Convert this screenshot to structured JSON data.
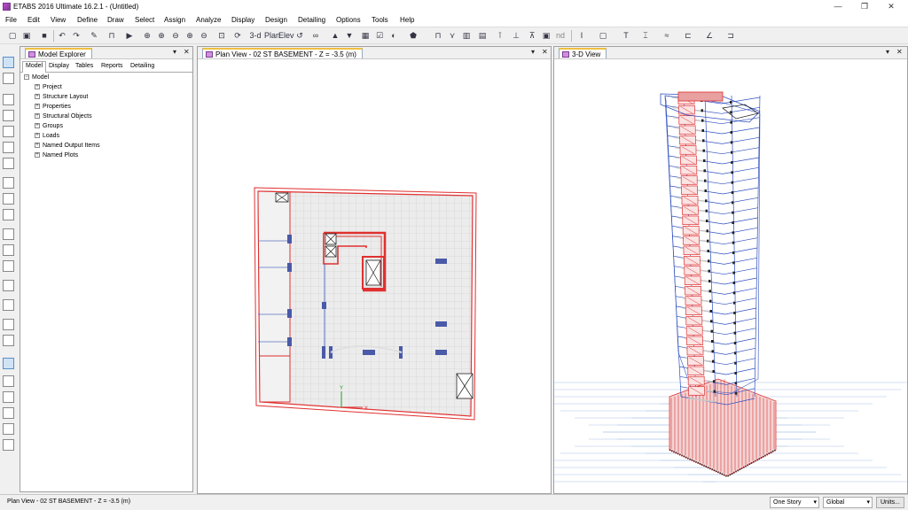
{
  "window": {
    "title": "ETABS 2016 Ultimate 16.2.1 - (Untitled)",
    "controls": [
      "—",
      "❐",
      "✕"
    ]
  },
  "menu": [
    "File",
    "Edit",
    "View",
    "Define",
    "Draw",
    "Select",
    "Assign",
    "Analyze",
    "Display",
    "Design",
    "Detailing",
    "Options",
    "Tools",
    "Help"
  ],
  "toolbar": {
    "view_3d_label": "3-d",
    "plan_label": "Plan",
    "elev_label": "Elev",
    "nd_label": "nd"
  },
  "model_explorer": {
    "title": "Model Explorer",
    "tabs": [
      "Model",
      "Display",
      "Tables",
      "Reports",
      "Detailing"
    ],
    "active_tab": "Model",
    "tree_root": "Model",
    "tree_items": [
      "Project",
      "Structure Layout",
      "Properties",
      "Structural Objects",
      "Groups",
      "Loads",
      "Named Output Items",
      "Named Plots"
    ]
  },
  "plan_view": {
    "title": "Plan View - 02 ST BASEMENT - Z = -3.5 (m)",
    "axis_y_label": "Y",
    "axis_x_label": "X"
  },
  "view_3d": {
    "title": "3-D View"
  },
  "status": {
    "text": "Plan View - 02 ST BASEMENT - Z = -3.5 (m)",
    "story_select": "One Story",
    "coord_select": "Global",
    "units_button": "Units..."
  },
  "colors": {
    "slab_grid": "#d8d8d8",
    "beam_red": "#e03030",
    "column_blue": "#4a5aa8",
    "frame_blue": "#3050c0",
    "active_tab_accent": "#f0c040"
  }
}
